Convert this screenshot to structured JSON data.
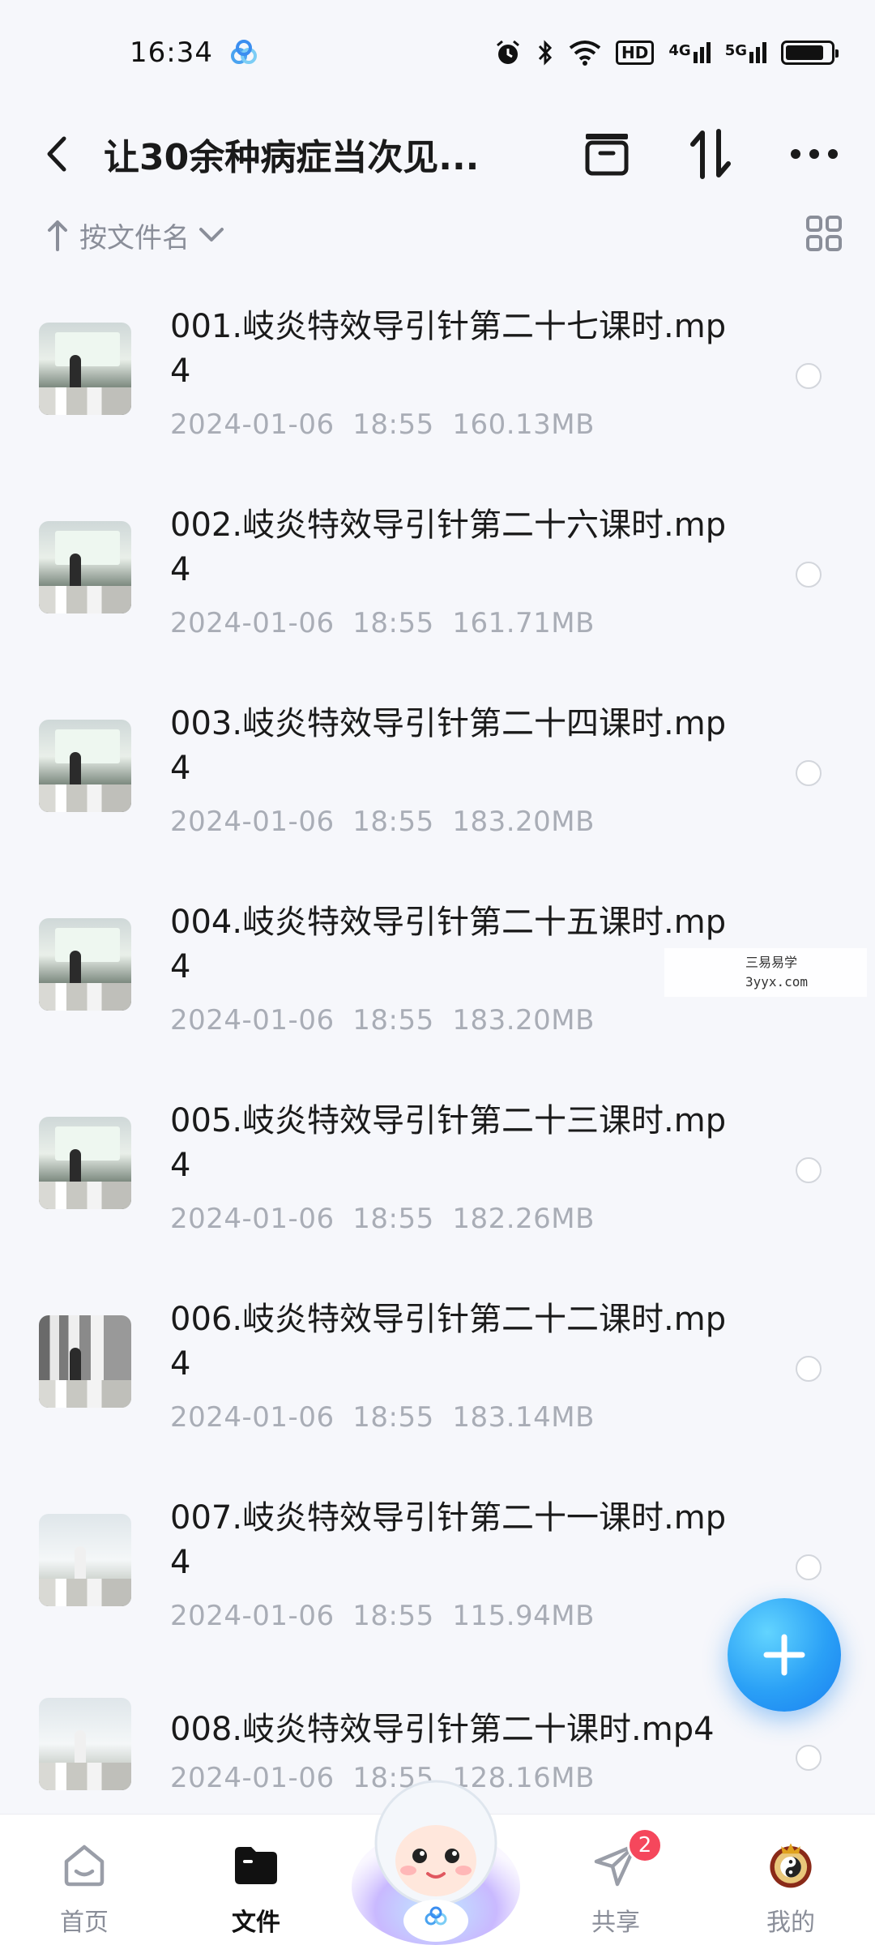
{
  "status_bar": {
    "time": "16:34",
    "hd_label": "HD",
    "net1": "4G",
    "net2": "5G"
  },
  "header": {
    "title": "让30余种病症当次见..."
  },
  "sort": {
    "label": "按文件名"
  },
  "files": [
    {
      "name": "001.岐炎特效导引针第二十七课时.mp4",
      "date": "2024-01-06",
      "time": "18:55",
      "size": "160.13MB"
    },
    {
      "name": "002.岐炎特效导引针第二十六课时.mp4",
      "date": "2024-01-06",
      "time": "18:55",
      "size": "161.71MB"
    },
    {
      "name": "003.岐炎特效导引针第二十四课时.mp4",
      "date": "2024-01-06",
      "time": "18:55",
      "size": "183.20MB"
    },
    {
      "name": "004.岐炎特效导引针第二十五课时.mp4",
      "date": "2024-01-06",
      "time": "18:55",
      "size": "183.20MB"
    },
    {
      "name": "005.岐炎特效导引针第二十三课时.mp4",
      "date": "2024-01-06",
      "time": "18:55",
      "size": "182.26MB"
    },
    {
      "name": "006.岐炎特效导引针第二十二课时.mp4",
      "date": "2024-01-06",
      "time": "18:55",
      "size": "183.14MB"
    },
    {
      "name": "007.岐炎特效导引针第二十一课时.mp4",
      "date": "2024-01-06",
      "time": "18:55",
      "size": "115.94MB"
    },
    {
      "name": "008.岐炎特效导引针第二十课时.mp4",
      "date": "2024-01-06",
      "time": "18:55",
      "size": "128.16MB"
    }
  ],
  "watermark": {
    "line1": "三易易学",
    "line2": "3yyx.com"
  },
  "bottom_nav": {
    "home": "首页",
    "files": "文件",
    "share": "共享",
    "share_badge": "2",
    "mine": "我的"
  },
  "colors": {
    "accent": "#2aa0f6",
    "badge": "#f5475c",
    "muted_text": "#a9adb6"
  }
}
